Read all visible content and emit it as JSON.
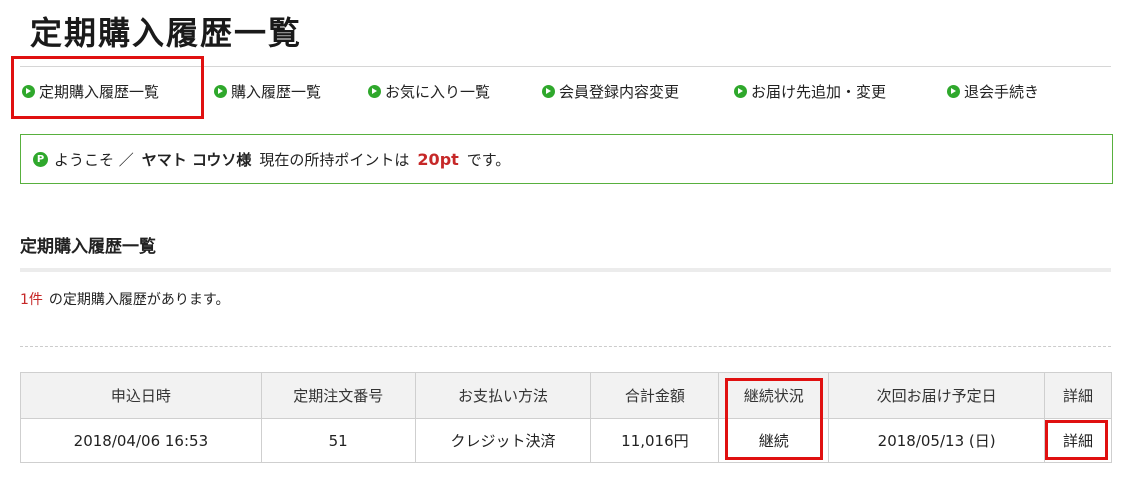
{
  "page": {
    "title": "定期購入履歴一覧"
  },
  "nav": {
    "items": [
      {
        "label": "定期購入履歴一覧"
      },
      {
        "label": "購入履歴一覧"
      },
      {
        "label": "お気に入り一覧"
      },
      {
        "label": "会員登録内容変更"
      },
      {
        "label": "お届け先追加・変更"
      },
      {
        "label": "退会手続き"
      }
    ]
  },
  "welcome": {
    "badge": "P",
    "greeting": "ようこそ ／",
    "name": "ヤマト コウソ様",
    "points_prefix": "現在の所持ポイントは",
    "points": "20pt",
    "points_suffix": "です。"
  },
  "section": {
    "title": "定期購入履歴一覧",
    "count": "1件",
    "count_suffix": "の定期購入履歴があります。"
  },
  "table": {
    "headers": [
      "申込日時",
      "定期注文番号",
      "お支払い方法",
      "合計金額",
      "継続状況",
      "次回お届け予定日",
      "詳細"
    ],
    "rows": [
      [
        "2018/04/06 16:53",
        "51",
        "クレジット決済",
        "11,016円",
        "継続",
        "2018/05/13 (日)",
        "詳細"
      ]
    ]
  },
  "colors": {
    "accent_green": "#2fa82c",
    "highlight_red": "#e01010",
    "emphasis_red": "#c62828"
  }
}
